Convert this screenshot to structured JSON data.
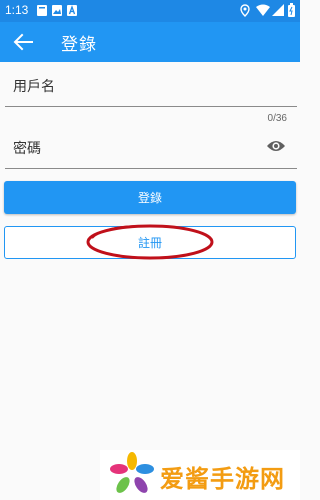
{
  "status_bar": {
    "time": "1:13",
    "left_icons": [
      "notification-box-icon",
      "image-icon",
      "a-letter-icon"
    ],
    "right_icons": [
      "location-icon",
      "wifi-icon",
      "signal-icon",
      "battery-icon"
    ]
  },
  "app_bar": {
    "title": "登錄",
    "back_icon": "arrow-left-icon",
    "color": "#2196f3"
  },
  "form": {
    "username_label": "用戶名",
    "username_counter": "0/36",
    "password_label": "密碼",
    "password_icon": "eye-icon"
  },
  "buttons": {
    "login_label": "登錄",
    "register_label": "註冊"
  },
  "watermark": {
    "text": "爱酱手游网"
  },
  "colors": {
    "primary": "#2196f3",
    "status_bar": "#1e88e5",
    "annotation": "#c0101a",
    "watermark_text": "#f39c12"
  }
}
